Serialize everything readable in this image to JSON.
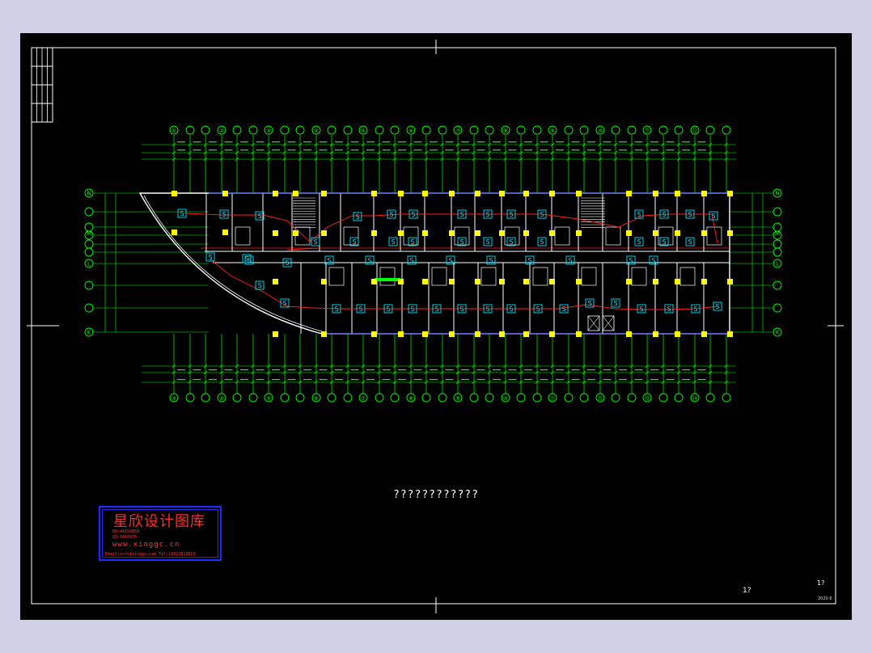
{
  "drawing": {
    "title": "????????????",
    "page_number": "1?",
    "page_number_small": "1?",
    "sheet_code": "2020.6"
  },
  "watermark": {
    "title": "星欣设计图库",
    "line1": "QQ:44159959",
    "line2": "QQ:9460976",
    "url": "www.xinggc.cn",
    "line4": "Email:info@xinggc.com  Tel:13813813813"
  },
  "axes": {
    "top_row": [
      "①",
      "②",
      "③",
      "④",
      "⑤",
      "⑥",
      "⑦",
      "⑧",
      "⑨",
      "⑩",
      "⑪",
      "⑫",
      "⑬",
      "⑭"
    ],
    "bottom_row": [
      "③",
      "④",
      "⑤",
      "⑥",
      "⑦",
      "⑧",
      "⑨",
      "⑩",
      "⑪",
      "⑫",
      "⑬",
      "⑭"
    ],
    "left_column": [
      "N",
      "M",
      "L",
      "K"
    ],
    "right_column": [
      "N",
      "M",
      "L",
      "K"
    ]
  },
  "colors": {
    "background": "#000000",
    "walls": "#ffffff",
    "columns": "#ffff00",
    "dimension_lines": "#00ff00",
    "fire_circuit": "#ff2020",
    "detectors": "#00e5ff",
    "frame": "#ffffff",
    "page": "#cfd0e6"
  }
}
